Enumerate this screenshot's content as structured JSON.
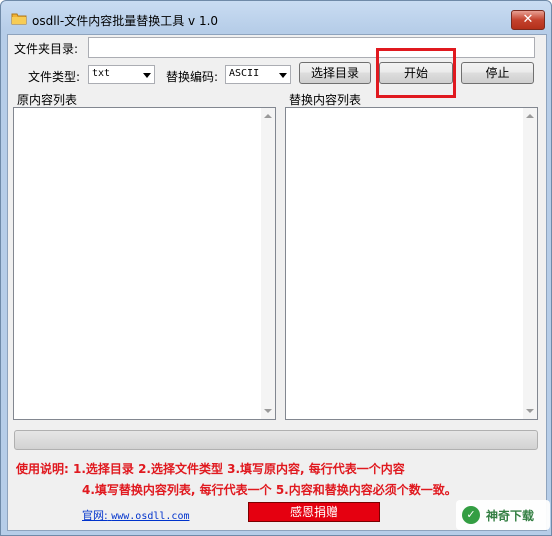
{
  "window": {
    "title": "osdll-文件内容批量替换工具 v 1.0",
    "close_symbol": "✕"
  },
  "folder": {
    "label": "文件夹目录:",
    "value": ""
  },
  "filetype": {
    "label": "文件类型:",
    "selected": "txt"
  },
  "encoding": {
    "label": "替换编码:",
    "selected": "ASCII"
  },
  "buttons": {
    "select_dir": "选择目录",
    "start": "开始",
    "stop": "停止"
  },
  "lists": {
    "original_label": "原内容列表",
    "replace_label": "替换内容列表"
  },
  "progress": {
    "value": 0
  },
  "instructions": {
    "line1": "使用说明: 1.选择目录   2.选择文件类型   3.填写原内容, 每行代表一个内容",
    "line2": "4.填写替换内容列表, 每行代表一个   5.内容和替换内容必须个数一致。"
  },
  "footer": {
    "site_label": "官网:",
    "site_url": "www.osdll.com",
    "thanks_button": "感恩捐赠"
  },
  "watermark": {
    "text": "神奇下载",
    "logo_glyph": "✓"
  },
  "colors": {
    "highlight": "#e0191f",
    "instruction_text": "#e0191f",
    "donate_button": "#e50010",
    "link": "#0033cc"
  }
}
